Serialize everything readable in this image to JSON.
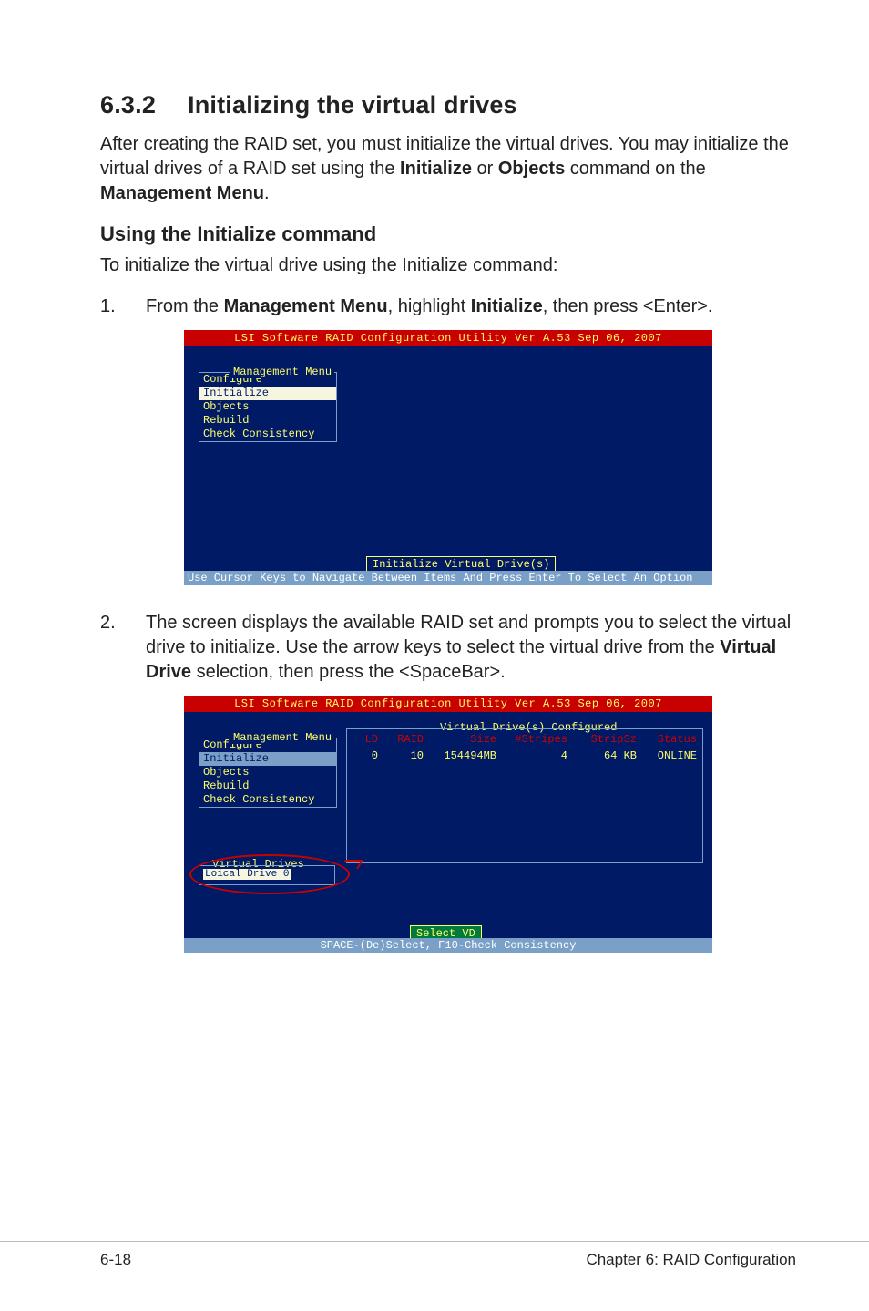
{
  "section": {
    "number": "6.3.2",
    "title": "Initializing the virtual drives"
  },
  "para1_pre": "After creating the RAID set, you must initialize the virtual drives. You may initialize the virtual drives of a RAID set using the ",
  "para1_b1": "Initialize",
  "para1_mid1": " or ",
  "para1_b2": "Objects",
  "para1_mid2": " command on the ",
  "para1_b3": "Management Menu",
  "para1_end": ".",
  "subheading": "Using the Initialize command",
  "para2": "To initialize the virtual drive using the Initialize command:",
  "steps": {
    "s1": {
      "num": "1.",
      "pre": "From the ",
      "b1": "Management Menu",
      "mid1": ", highlight ",
      "b2": "Initialize",
      "end": ", then press <Enter>."
    },
    "s2": {
      "num": "2.",
      "pre": "The screen displays the available RAID set and prompts you to select the virtual drive to initialize. Use the arrow keys to select the virtual drive from the ",
      "b1": "Virtual Drive",
      "end": " selection, then press the <SpaceBar>."
    }
  },
  "bios": {
    "title": "LSI Software RAID Configuration Utility Ver A.53 Sep 06, 2007",
    "menu_label": "Management Menu",
    "items": {
      "configure": "Configure",
      "initialize": "Initialize",
      "objects": "Objects",
      "rebuild": "Rebuild",
      "check": "Check Consistency"
    },
    "init_box": "Initialize Virtual Drive(s)",
    "help1": "Use Cursor Keys to Navigate Between Items And Press Enter To Select An Option",
    "vd_table_label": "Virtual Drive(s) Configured",
    "vd_head": {
      "ld": "LD",
      "raid": "RAID",
      "size": "Size",
      "stripes": "#Stripes",
      "stripsz": "StripSz",
      "status": "Status"
    },
    "vd_row": {
      "ld": "0",
      "raid": "10",
      "size": "154494MB",
      "stripes": "4",
      "stripsz": "64 KB",
      "status": "ONLINE"
    },
    "vdrives_label": "Virtual Drives",
    "vdrives_item": "Loical Drive 0",
    "select_vd": "Select VD",
    "help2": "SPACE-(De)Select, F10-Check Consistency"
  },
  "chart_data": {
    "type": "table",
    "title": "Virtual Drive(s) Configured",
    "columns": [
      "LD",
      "RAID",
      "Size",
      "#Stripes",
      "StripSz",
      "Status"
    ],
    "rows": [
      [
        "0",
        "10",
        "154494MB",
        "4",
        "64 KB",
        "ONLINE"
      ]
    ]
  },
  "footer": {
    "left": "6-18",
    "right": "Chapter 6: RAID Configuration"
  }
}
